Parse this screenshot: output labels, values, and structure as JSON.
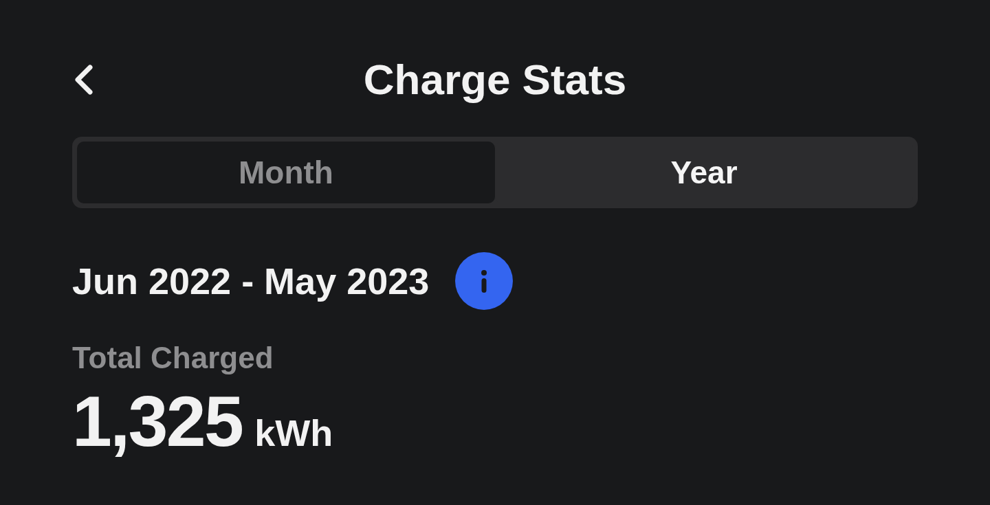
{
  "header": {
    "title": "Charge Stats"
  },
  "tabs": [
    {
      "label": "Month",
      "selected": false
    },
    {
      "label": "Year",
      "selected": true
    }
  ],
  "period": {
    "label": "Jun 2022 - May 2023"
  },
  "total": {
    "label": "Total Charged",
    "value": "1,325",
    "unit": "kWh"
  }
}
